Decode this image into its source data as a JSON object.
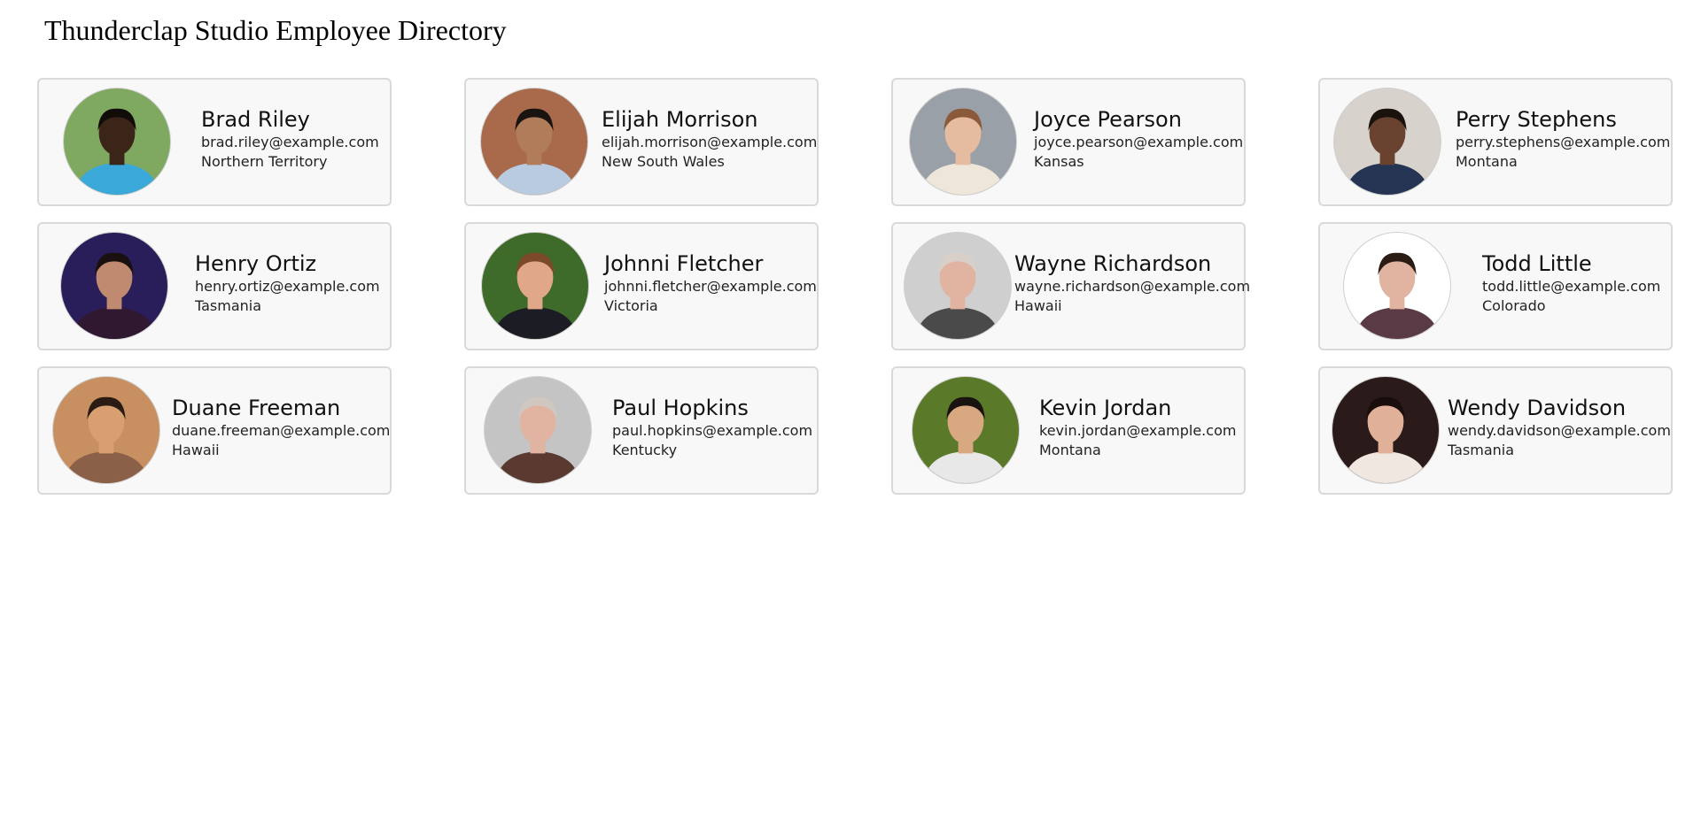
{
  "page": {
    "title": "Thunderclap Studio Employee Directory"
  },
  "employees": [
    {
      "name": "Brad Riley",
      "email": "brad.riley@example.com",
      "location": "Northern Territory",
      "avatar": {
        "bg": "#7fa860",
        "skin": "#3b2418",
        "hair": "#120c08",
        "shirt": "#3aa8d8"
      }
    },
    {
      "name": "Elijah Morrison",
      "email": "elijah.morrison@example.com",
      "location": "New South Wales",
      "avatar": {
        "bg": "#a86a4a",
        "skin": "#b07c5a",
        "hair": "#1a1410",
        "shirt": "#b9cbe0"
      }
    },
    {
      "name": "Joyce Pearson",
      "email": "joyce.pearson@example.com",
      "location": "Kansas",
      "avatar": {
        "bg": "#9aa0a8",
        "skin": "#e6bca0",
        "hair": "#8a5a3a",
        "shirt": "#efe6da"
      }
    },
    {
      "name": "Perry Stephens",
      "email": "perry.stephens@example.com",
      "location": "Montana",
      "avatar": {
        "bg": "#d8d2cc",
        "skin": "#6a4230",
        "hair": "#1a120c",
        "shirt": "#243452"
      }
    },
    {
      "name": "Henry Ortiz",
      "email": "henry.ortiz@example.com",
      "location": "Tasmania",
      "avatar": {
        "bg": "#2a1e5a",
        "skin": "#c08a70",
        "hair": "#1a1010",
        "shirt": "#301830"
      }
    },
    {
      "name": "Johnni Fletcher",
      "email": "johnni.fletcher@example.com",
      "location": "Victoria",
      "avatar": {
        "bg": "#3e6a2a",
        "skin": "#e0a888",
        "hair": "#7a4a2a",
        "shirt": "#1c1c24"
      }
    },
    {
      "name": "Wayne Richardson",
      "email": "wayne.richardson@example.com",
      "location": "Hawaii",
      "avatar": {
        "bg": "#cfcfcf",
        "skin": "#e0b4a0",
        "hair": "#d8d0c8",
        "shirt": "#4a4a4a"
      }
    },
    {
      "name": "Todd Little",
      "email": "todd.little@example.com",
      "location": "Colorado",
      "avatar": {
        "bg": "#ffffff",
        "skin": "#e0b4a0",
        "hair": "#2a1c14",
        "shirt": "#5a3a44"
      }
    },
    {
      "name": "Duane Freeman",
      "email": "duane.freeman@example.com",
      "location": "Hawaii",
      "avatar": {
        "bg": "#c89060",
        "skin": "#d8a070",
        "hair": "#2a1c14",
        "shirt": "#8a6048"
      }
    },
    {
      "name": "Paul Hopkins",
      "email": "paul.hopkins@example.com",
      "location": "Kentucky",
      "avatar": {
        "bg": "#c4c4c4",
        "skin": "#e0b4a0",
        "hair": "#d0c8c0",
        "shirt": "#5a3a30"
      }
    },
    {
      "name": "Kevin Jordan",
      "email": "kevin.jordan@example.com",
      "location": "Montana",
      "avatar": {
        "bg": "#5a7a2a",
        "skin": "#d8a880",
        "hair": "#1a1410",
        "shirt": "#e8e8e8"
      }
    },
    {
      "name": "Wendy Davidson",
      "email": "wendy.davidson@example.com",
      "location": "Tasmania",
      "avatar": {
        "bg": "#2a1a1a",
        "skin": "#e0b098",
        "hair": "#1a0e0c",
        "shirt": "#f0e8e0"
      }
    }
  ]
}
